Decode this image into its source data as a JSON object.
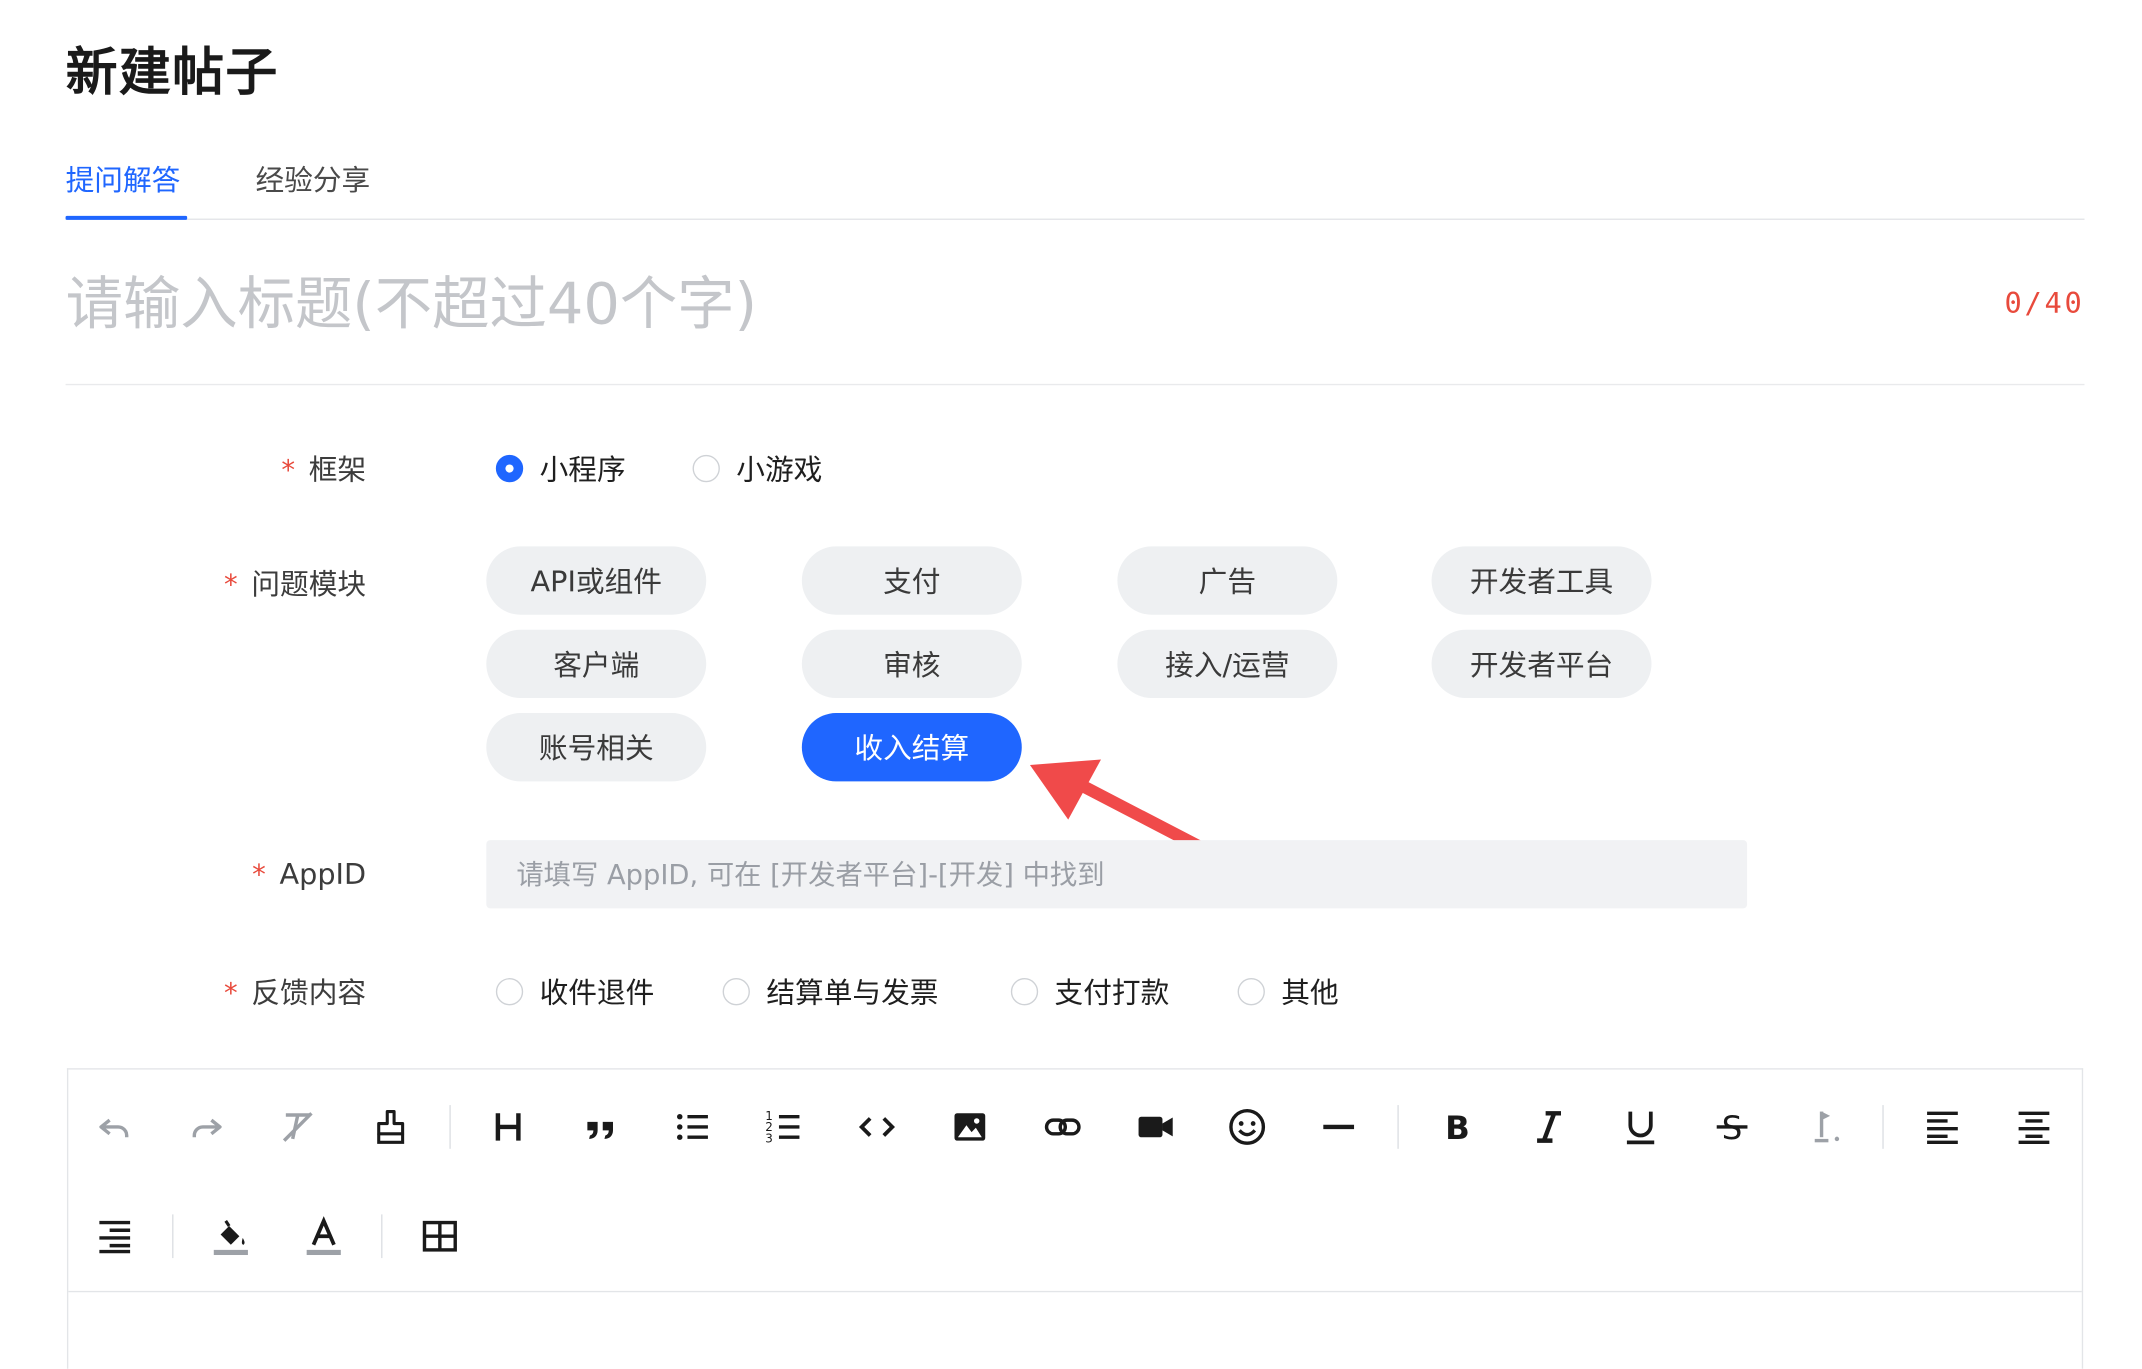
{
  "page": {
    "title": "新建帖子"
  },
  "tabs": [
    {
      "label": "提问解答",
      "active": true
    },
    {
      "label": "经验分享",
      "active": false
    }
  ],
  "title_field": {
    "placeholder": "请输入标题(不超过40个字)",
    "value": "",
    "counter": "0/40"
  },
  "form": {
    "required_mark": "*",
    "framework": {
      "label": "框架",
      "options": [
        {
          "label": "小程序",
          "checked": true
        },
        {
          "label": "小游戏",
          "checked": false
        }
      ]
    },
    "module": {
      "label": "问题模块",
      "chips": [
        {
          "label": "API或组件",
          "selected": false
        },
        {
          "label": "支付",
          "selected": false
        },
        {
          "label": "广告",
          "selected": false
        },
        {
          "label": "开发者工具",
          "selected": false
        },
        {
          "label": "客户端",
          "selected": false
        },
        {
          "label": "审核",
          "selected": false
        },
        {
          "label": "接入/运营",
          "selected": false
        },
        {
          "label": "开发者平台",
          "selected": false
        },
        {
          "label": "账号相关",
          "selected": false
        },
        {
          "label": "收入结算",
          "selected": true
        }
      ]
    },
    "appid": {
      "label": "AppID",
      "placeholder": "请填写 AppID, 可在 [开发者平台]-[开发] 中找到",
      "value": ""
    },
    "feedback": {
      "label": "反馈内容",
      "options": [
        {
          "label": "收件退件",
          "checked": false
        },
        {
          "label": "结算单与发票",
          "checked": false
        },
        {
          "label": "支付打款",
          "checked": false
        },
        {
          "label": "其他",
          "checked": false
        }
      ]
    }
  },
  "editor": {
    "toolbar": [
      "undo-icon",
      "redo-icon",
      "clear-format-icon",
      "format-painter-icon",
      "heading-icon",
      "blockquote-icon",
      "bullet-list-icon",
      "numbered-list-icon",
      "code-icon",
      "image-icon",
      "link-icon",
      "video-icon",
      "emoji-icon",
      "divider-line-icon",
      "bold-icon",
      "italic-icon",
      "underline-icon",
      "strikethrough-icon",
      "indent-icon",
      "align-left-icon",
      "align-center-icon",
      "align-right-icon",
      "background-color-icon",
      "font-color-icon",
      "table-icon"
    ]
  },
  "colors": {
    "accent": "#1f66ff",
    "required": "#e84a3c",
    "annotation_arrow": "#f04a4a",
    "chip_bg": "#eef0f2"
  }
}
